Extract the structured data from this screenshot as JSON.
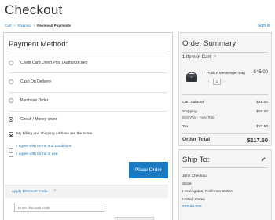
{
  "header": {
    "title": "Checkout",
    "signin": "Sign In",
    "steps": {
      "cart": "Cart",
      "sep1": ">",
      "shipping": "Shipping",
      "sep2": ">",
      "review": "Review & Payments"
    }
  },
  "payment": {
    "title": "Payment Method:",
    "methods": [
      {
        "label": "Credit Card Direct Post (Authorize.net)",
        "selected": false
      },
      {
        "label": "Cash On Delivery",
        "selected": false
      },
      {
        "label": "Purchase Order",
        "selected": false
      },
      {
        "label": "Check / Money order",
        "selected": true
      }
    ],
    "same_address": "My billing and shipping address are the same",
    "terms": [
      "I agree with terms and conditions",
      "I agree with terms of use"
    ],
    "place_order": "Place Order",
    "discount": {
      "label": "Apply Discount Code",
      "placeholder": "Enter discount code"
    }
  },
  "summary": {
    "title": "Order Summary",
    "items_in_cart": "1 Item in Cart",
    "product": {
      "name": "Push It Messenger Bag",
      "price": "$45.00",
      "qty": "1"
    },
    "totals": [
      {
        "label": "Cart Subtotal",
        "value": "$45.00"
      },
      {
        "label": "Shipping",
        "value": "$50.00"
      },
      {
        "label": "Tax",
        "value": "$22.50"
      }
    ],
    "shipping_method": "Best Way - Table Rate",
    "order_total": {
      "label": "Order Total",
      "value": "$117.50"
    }
  },
  "ship_to": {
    "title": "Ship To:",
    "lines": [
      "John Checkout",
      "Street",
      "Los Angeles, California 90064",
      "United States",
      "555-55-555"
    ]
  },
  "colors": {
    "accent": "#1979c3",
    "panel": "#f5f5f5"
  }
}
